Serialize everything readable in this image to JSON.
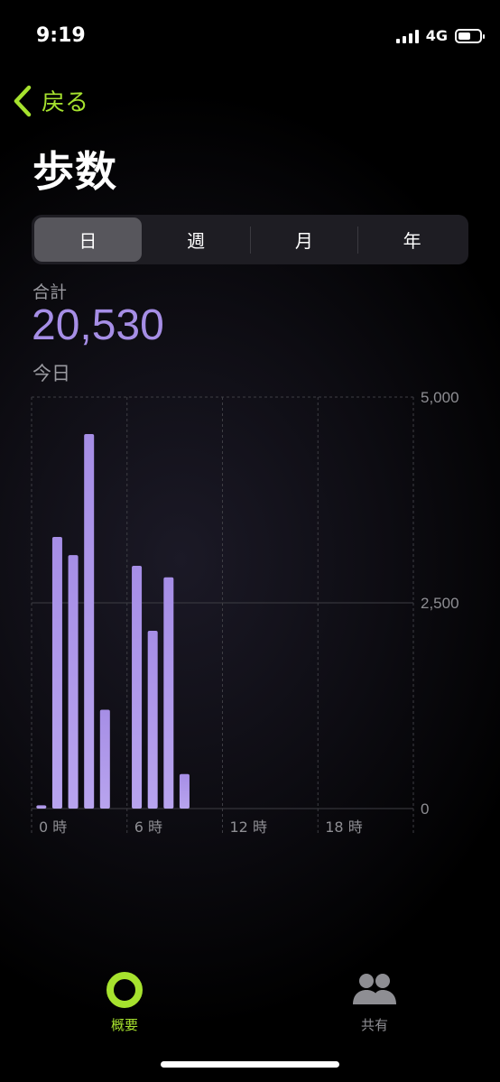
{
  "status": {
    "time": "9:19",
    "network": "4G",
    "battery_level": 0.6
  },
  "nav": {
    "back_label": "戻る"
  },
  "page": {
    "title": "歩数"
  },
  "segments": [
    {
      "label": "日",
      "active": true
    },
    {
      "label": "週",
      "active": false
    },
    {
      "label": "月",
      "active": false
    },
    {
      "label": "年",
      "active": false
    }
  ],
  "summary": {
    "label": "合計",
    "value": "20,530",
    "date_label": "今日"
  },
  "colors": {
    "accent_green": "#a6e22e",
    "bar_purple": "#a68ee6",
    "grid": "#3a3a3f"
  },
  "chart_data": {
    "type": "bar",
    "x_unit": "hour",
    "x": [
      0,
      1,
      2,
      3,
      4,
      5,
      6,
      7,
      8,
      9,
      10,
      11,
      12,
      13,
      14,
      15,
      16,
      17,
      18,
      19,
      20,
      21,
      22,
      23
    ],
    "values": [
      40,
      3300,
      3080,
      4550,
      1200,
      0,
      2950,
      2160,
      2810,
      420,
      0,
      0,
      0,
      0,
      0,
      0,
      0,
      0,
      0,
      0,
      0,
      0,
      0,
      0
    ],
    "ylim": [
      0,
      5000
    ],
    "y_ticks": [
      "5,000",
      "2,500",
      "0"
    ],
    "y_tick_values": [
      5000,
      2500,
      0
    ],
    "x_ticks": [
      "0 時",
      "6 時",
      "12 時",
      "18 時"
    ],
    "x_tick_values": [
      0,
      6,
      12,
      18
    ],
    "grid": true
  },
  "tabs": [
    {
      "label": "概要",
      "icon": "activity-ring-icon",
      "active": true
    },
    {
      "label": "共有",
      "icon": "sharing-people-icon",
      "active": false
    }
  ]
}
